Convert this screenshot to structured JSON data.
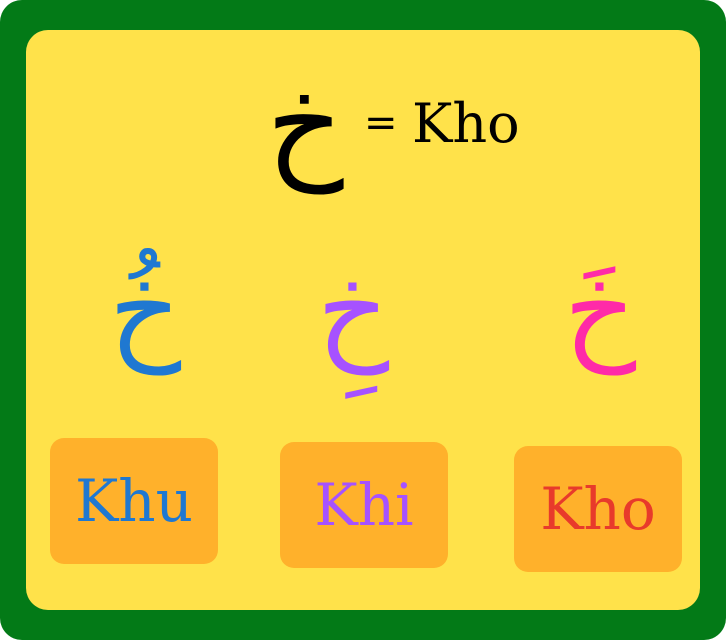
{
  "main": {
    "letter": "خ",
    "equals": "=",
    "word": "Kho"
  },
  "variants": [
    {
      "letter": "خُ",
      "label": "Khu",
      "color": "#1f78d1"
    },
    {
      "letter": "خِ",
      "label": "Khi",
      "color": "#a652ff"
    },
    {
      "letter": "خَ",
      "label": "Kho",
      "color": "#ff2aa8"
    }
  ],
  "card_label_colors": [
    "#1f78d1",
    "#a652ff",
    "#e83a2b"
  ],
  "colors": {
    "frame": "#037a17",
    "panel": "#ffe24a",
    "card": "#ffb12b"
  }
}
